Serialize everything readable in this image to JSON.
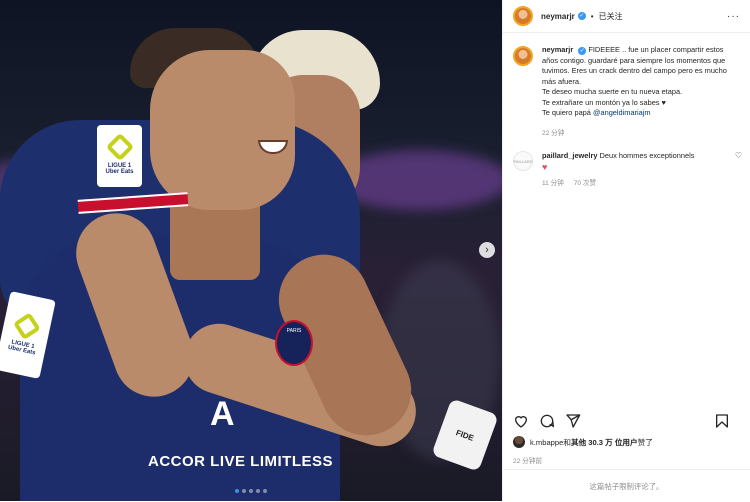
{
  "post": {
    "username": "neymarjr",
    "follow_status": "已关注",
    "caption": {
      "line1": "FIDEEEE .. fue un placer compartir estos años contigo. guardaré para siempre los momentos que tuvimos. Eres un crack dentro del campo pero es mucho más afuera.",
      "line2": "Te deseo mucha suerte en tu nueva etapa.",
      "line3": "Te extrañare un montón ya lo sabes ♥",
      "line4_prefix": "Te quiero papá",
      "mention": "@angeldimariajm",
      "time": "22 分钟"
    },
    "comments": [
      {
        "username": "paillard_jewelry",
        "text": "Deux hommes exceptionnels",
        "emoji": "♥",
        "time": "11 分钟",
        "likes": "70 次赞"
      }
    ],
    "likes_line": {
      "user": "k.mbappe",
      "conj": " 和 ",
      "others": "其他 30.3 万 位用户",
      "suffix": " 赞了"
    },
    "post_time": "22 分钟前",
    "comments_closed": "这篇帖子限制评论了。"
  },
  "photo": {
    "patch_top": {
      "line1": "LIGUE 1",
      "line2": "Uber Eats"
    },
    "patch_left": {
      "line1": "LIGUE 1",
      "line2": "Uber Eats"
    },
    "sponsor": "ACCOR LIVE LIMITLESS",
    "crest": "PARIS",
    "wristband": "FIDE"
  },
  "icons": [
    "next-arrow-icon",
    "heart-icon",
    "comment-icon",
    "share-icon",
    "bookmark-icon",
    "verified-icon",
    "more-icon"
  ],
  "colors": {
    "accent": "#3897f0",
    "mention": "#00376b",
    "muted": "#8e8e8e",
    "jersey": "#1c2f6b"
  }
}
